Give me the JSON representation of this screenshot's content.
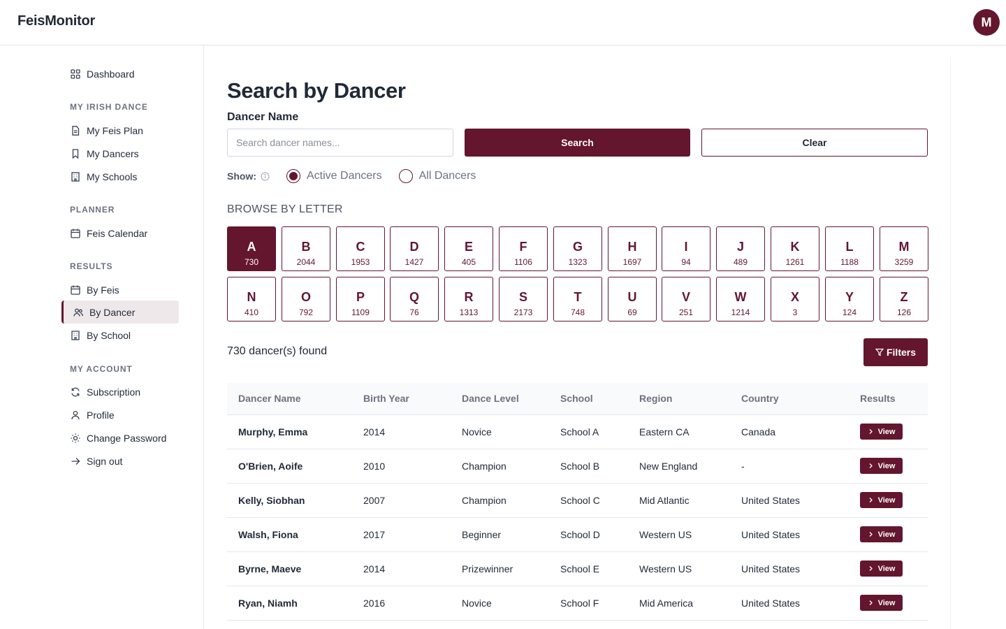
{
  "app": {
    "brand": "FeisMonitor",
    "avatar_initial": "M",
    "accent_color": "#63162e"
  },
  "sidebar": {
    "top_item": {
      "label": "Dashboard",
      "icon": "grid-icon"
    },
    "sections": [
      {
        "heading": "MY IRISH DANCE",
        "items": [
          {
            "label": "My Feis Plan",
            "icon": "document-icon"
          },
          {
            "label": "My Dancers",
            "icon": "bookmark-icon"
          },
          {
            "label": "My Schools",
            "icon": "building-icon"
          }
        ]
      },
      {
        "heading": "PLANNER",
        "items": [
          {
            "label": "Feis Calendar",
            "icon": "calendar-icon"
          }
        ]
      },
      {
        "heading": "RESULTS",
        "items": [
          {
            "label": "By Feis",
            "icon": "calendar-icon"
          },
          {
            "label": "By Dancer",
            "icon": "users-icon",
            "active": true
          },
          {
            "label": "By School",
            "icon": "building-icon"
          }
        ]
      },
      {
        "heading": "MY ACCOUNT",
        "items": [
          {
            "label": "Subscription",
            "icon": "refresh-icon"
          },
          {
            "label": "Profile",
            "icon": "user-icon"
          },
          {
            "label": "Change Password",
            "icon": "sun-gear-icon"
          },
          {
            "label": "Sign out",
            "icon": "arrow-right-icon"
          }
        ]
      }
    ]
  },
  "page": {
    "title": "Search by Dancer",
    "field_label": "Dancer Name",
    "search_placeholder": "Search dancer names...",
    "search_button": "Search",
    "clear_button": "Clear",
    "show_label": "Show:",
    "show_options": [
      {
        "label": "Active Dancers",
        "selected": true
      },
      {
        "label": "All Dancers",
        "selected": false
      }
    ],
    "browse_label": "BROWSE BY LETTER",
    "letters": [
      {
        "letter": "A",
        "count": "730",
        "selected": true
      },
      {
        "letter": "B",
        "count": "2044"
      },
      {
        "letter": "C",
        "count": "1953"
      },
      {
        "letter": "D",
        "count": "1427"
      },
      {
        "letter": "E",
        "count": "405"
      },
      {
        "letter": "F",
        "count": "1106"
      },
      {
        "letter": "G",
        "count": "1323"
      },
      {
        "letter": "H",
        "count": "1697"
      },
      {
        "letter": "I",
        "count": "94"
      },
      {
        "letter": "J",
        "count": "489"
      },
      {
        "letter": "K",
        "count": "1261"
      },
      {
        "letter": "L",
        "count": "1188"
      },
      {
        "letter": "M",
        "count": "3259"
      },
      {
        "letter": "N",
        "count": "410"
      },
      {
        "letter": "O",
        "count": "792"
      },
      {
        "letter": "P",
        "count": "1109"
      },
      {
        "letter": "Q",
        "count": "76"
      },
      {
        "letter": "R",
        "count": "1313"
      },
      {
        "letter": "S",
        "count": "2173"
      },
      {
        "letter": "T",
        "count": "748"
      },
      {
        "letter": "U",
        "count": "69"
      },
      {
        "letter": "V",
        "count": "251"
      },
      {
        "letter": "W",
        "count": "1214"
      },
      {
        "letter": "X",
        "count": "3"
      },
      {
        "letter": "Y",
        "count": "124"
      },
      {
        "letter": "Z",
        "count": "126"
      }
    ],
    "results_count": "730 dancer(s) found",
    "filters_button": "Filters"
  },
  "table": {
    "headers": [
      "Dancer Name",
      "Birth Year",
      "Dance Level",
      "School",
      "Region",
      "Country",
      "Results"
    ],
    "view_label": "View",
    "rows": [
      [
        "Murphy, Emma",
        "2014",
        "Novice",
        "School A",
        "Eastern CA",
        "Canada"
      ],
      [
        "O'Brien, Aoife",
        "2010",
        "Champion",
        "School B",
        "New England",
        "-"
      ],
      [
        "Kelly, Siobhan",
        "2007",
        "Champion",
        "School C",
        "Mid Atlantic",
        "United States"
      ],
      [
        "Walsh, Fiona",
        "2017",
        "Beginner",
        "School D",
        "Western US",
        "United States"
      ],
      [
        "Byrne, Maeve",
        "2014",
        "Prizewinner",
        "School E",
        "Western US",
        "United States"
      ],
      [
        "Ryan, Niamh",
        "2016",
        "Novice",
        "School F",
        "Mid America",
        "United States"
      ]
    ]
  }
}
